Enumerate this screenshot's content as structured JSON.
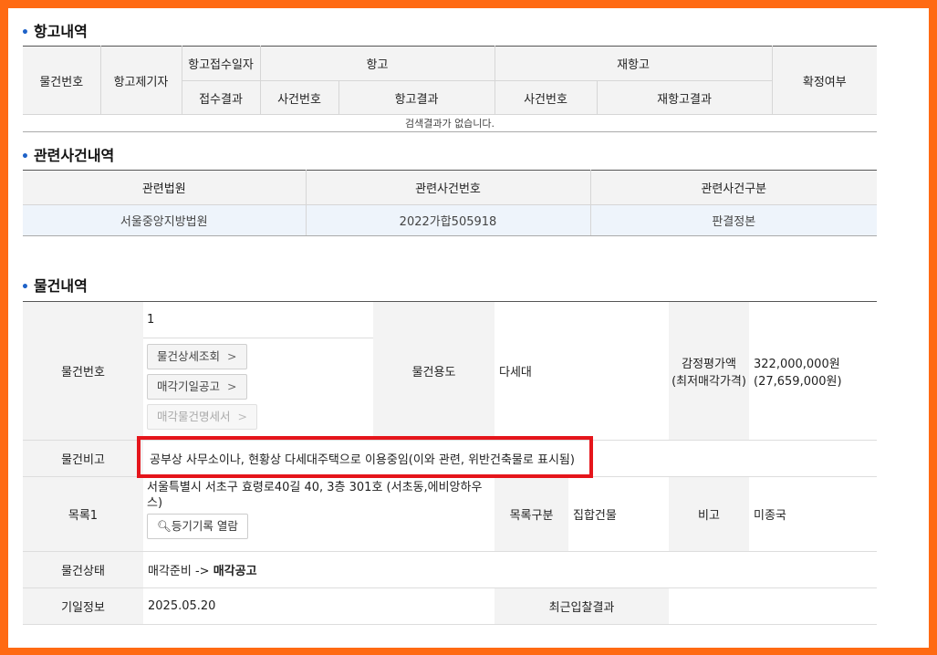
{
  "appeal": {
    "title": "항고내역",
    "headers": {
      "item_no": "물건번호",
      "appellant": "항고제기자",
      "received_date": "항고접수일자",
      "appeal": "항고",
      "reappeal": "재항고",
      "confirmed": "확정여부",
      "received_result": "접수결과",
      "case_no": "사건번호",
      "appeal_result": "항고결과",
      "re_case_no": "사건번호",
      "reappeal_result": "재항고결과"
    },
    "empty_message": "검색결과가 없습니다."
  },
  "related": {
    "title": "관련사건내역",
    "headers": [
      "관련법원",
      "관련사건번호",
      "관련사건구분"
    ],
    "row": {
      "court": "서울중앙지방법원",
      "case_no": "2022가합505918",
      "type": "판결정본"
    }
  },
  "item": {
    "title": "물건내역",
    "labels": {
      "item_no": "물건번호",
      "usage": "물건용도",
      "appraisal": "감정평가액",
      "min_price_label": "(최저매각가격)",
      "note": "물건비고",
      "list1": "목록1",
      "list_type": "목록구분",
      "remark": "비고",
      "status": "물건상태",
      "date_info": "기일정보",
      "recent_bid": "최근입찰결과"
    },
    "item_no": "1",
    "buttons": {
      "detail": "물건상세조회",
      "sale_notice": "매각기일공고",
      "spec": "매각물건명세서",
      "registry": "등기기록 열람"
    },
    "usage": "다세대",
    "appraisal_value": "322,000,000원",
    "min_price_value": "(27,659,000원)",
    "note_text": "공부상 사무소이나, 현황상 다세대주택으로 이용중임(이와 관련, 위반건축물로 표시됨)",
    "address_line1": "서울특별시 서초구 효령로40길 40, 3층 301호 (서초동,에비앙하우",
    "address_line2": "스)",
    "list_type_value": "집합건물",
    "remark_value": "미종국",
    "status_prefix": "매각준비 ->",
    "status_bold": "매각공고",
    "date_value": "2025.05.20",
    "recent_bid_value": ""
  },
  "colors": {
    "frame": "#ff6a13",
    "highlight": "#e5151b",
    "bullet": "#1e62c8"
  }
}
